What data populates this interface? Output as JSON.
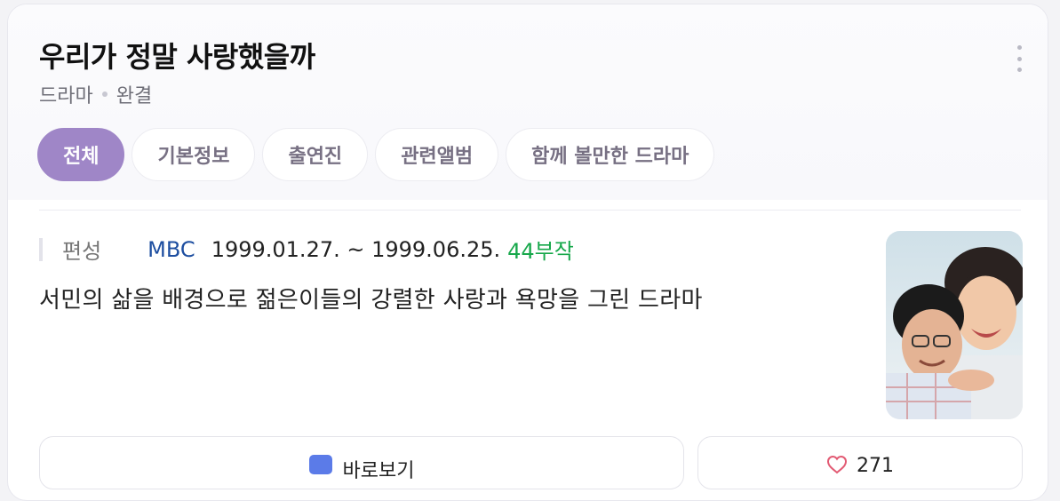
{
  "header": {
    "title": "우리가 정말 사랑했을까",
    "genre": "드라마",
    "status": "완결"
  },
  "tabs": [
    {
      "label": "전체",
      "active": true
    },
    {
      "label": "기본정보"
    },
    {
      "label": "출연진"
    },
    {
      "label": "관련앨범"
    },
    {
      "label": "함께 볼만한 드라마"
    }
  ],
  "info": {
    "label": "편성",
    "channel": "MBC",
    "dates": "1999.01.27. ~ 1999.06.25.",
    "episodes": "44부작",
    "description": "서민의 삶을 배경으로 젊은이들의 강렬한 사랑과 욕망을 그린 드라마"
  },
  "actions": {
    "watch_label": "바로보기",
    "like_count": "271"
  },
  "icons": {
    "more": "more-vertical-icon",
    "watch": "play-icon",
    "like": "heart-icon"
  },
  "colors": {
    "accent": "#9f86c7",
    "channel": "#1d4ea0",
    "episodes": "#17a84b"
  }
}
